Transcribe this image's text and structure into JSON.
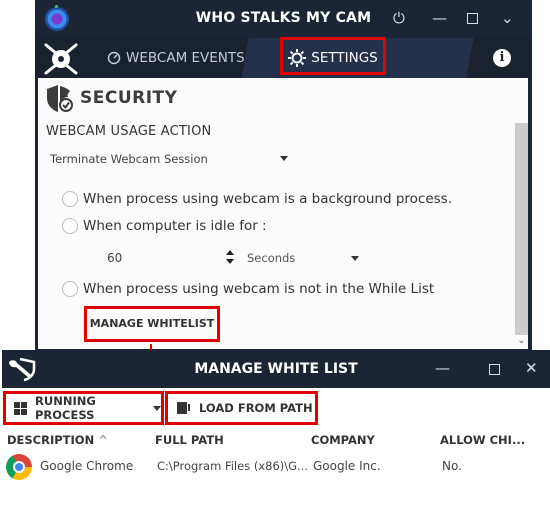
{
  "main_window": {
    "title": "WHO STALKS MY CAM",
    "tabs": [
      {
        "label": "WEBCAM EVENTS",
        "icon": "gauge-icon",
        "active": false
      },
      {
        "label": "SETTINGS",
        "icon": "gear-icon",
        "active": true
      }
    ],
    "info_glyph": "i",
    "section_title": "SECURITY",
    "usage_action_label": "WEBCAM USAGE ACTION",
    "usage_action_value": "Terminate Webcam Session",
    "options": [
      {
        "label": "When process using webcam is a background process.",
        "checked": false
      },
      {
        "label": "When computer is idle for :",
        "checked": false
      },
      {
        "label": "When process using webcam is not in the While List",
        "checked": false
      }
    ],
    "idle_value": "60",
    "idle_unit": "Seconds",
    "manage_whitelist_label": "MANAGE WHITELIST",
    "window_controls": {
      "minimize": "—",
      "chevron": "⌄",
      "power": "⏻"
    }
  },
  "whitelist_window": {
    "title": "MANAGE WHITE LIST",
    "toolbar": {
      "running_process_label": "RUNNING PROCESS",
      "load_from_path_label": "LOAD FROM PATH"
    },
    "columns": [
      "DESCRIPTION",
      "FULL PATH",
      "COMPANY",
      "ALLOW CHI..."
    ],
    "sort_indicator": "^",
    "rows": [
      {
        "description": "Google Chrome",
        "full_path": "C:\\Program Files (x86)\\G...",
        "company": "Google Inc.",
        "allow_child": "No."
      }
    ],
    "window_controls": {
      "minimize": "—",
      "close": "✕"
    }
  },
  "annotation_color": "#e00000"
}
